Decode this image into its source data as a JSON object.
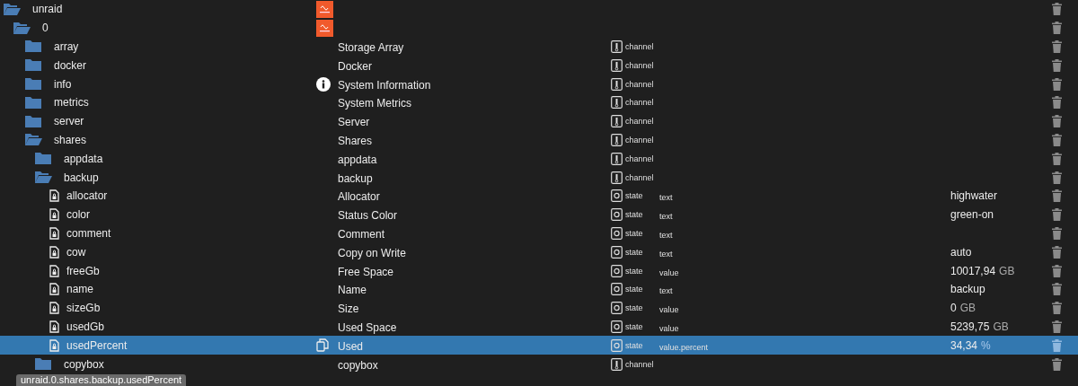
{
  "tree": [
    {
      "name": "unraid",
      "kind": "device",
      "expanded": true,
      "selected": false,
      "logo": true,
      "children": [
        {
          "name": "0",
          "kind": "device",
          "expanded": true,
          "selected": false,
          "logo": true,
          "children": [
            {
              "name": "array",
              "kind": "channel",
              "expanded": false,
              "selected": false,
              "title": "Storage Array",
              "role": "channel"
            },
            {
              "name": "docker",
              "kind": "channel",
              "expanded": false,
              "selected": false,
              "title": "Docker",
              "role": "channel"
            },
            {
              "name": "info",
              "kind": "channel",
              "expanded": false,
              "selected": false,
              "info_icon": true,
              "title": "System Information",
              "role": "channel"
            },
            {
              "name": "metrics",
              "kind": "channel",
              "expanded": false,
              "selected": false,
              "title": "System Metrics",
              "role": "channel"
            },
            {
              "name": "server",
              "kind": "channel",
              "expanded": false,
              "selected": false,
              "title": "Server",
              "role": "channel"
            },
            {
              "name": "shares",
              "kind": "channel",
              "expanded": true,
              "selected": false,
              "title": "Shares",
              "role": "channel",
              "children": [
                {
                  "name": "appdata",
                  "kind": "channel",
                  "expanded": false,
                  "selected": false,
                  "title": "appdata",
                  "role": "channel"
                },
                {
                  "name": "backup",
                  "kind": "channel",
                  "expanded": true,
                  "selected": false,
                  "title": "backup",
                  "role": "channel",
                  "children": [
                    {
                      "name": "allocator",
                      "kind": "state",
                      "selected": false,
                      "title": "Allocator",
                      "role": "state",
                      "type": "text",
                      "value": "highwater"
                    },
                    {
                      "name": "color",
                      "kind": "state",
                      "selected": false,
                      "title": "Status Color",
                      "role": "state",
                      "type": "text",
                      "value": "green-on"
                    },
                    {
                      "name": "comment",
                      "kind": "state",
                      "selected": false,
                      "title": "Comment",
                      "role": "state",
                      "type": "text"
                    },
                    {
                      "name": "cow",
                      "kind": "state",
                      "selected": false,
                      "title": "Copy on Write",
                      "role": "state",
                      "type": "text",
                      "value": "auto"
                    },
                    {
                      "name": "freeGb",
                      "kind": "state",
                      "selected": false,
                      "title": "Free Space",
                      "role": "state",
                      "type": "value",
                      "value": "10017,94",
                      "unit": "GB"
                    },
                    {
                      "name": "name",
                      "kind": "state",
                      "selected": false,
                      "title": "Name",
                      "role": "state",
                      "type": "text",
                      "value": "backup"
                    },
                    {
                      "name": "sizeGb",
                      "kind": "state",
                      "selected": false,
                      "title": "Size",
                      "role": "state",
                      "type": "value",
                      "value": "0",
                      "unit": "GB"
                    },
                    {
                      "name": "usedGb",
                      "kind": "state",
                      "selected": false,
                      "title": "Used Space",
                      "role": "state",
                      "type": "value",
                      "value": "5239,75",
                      "unit": "GB"
                    },
                    {
                      "name": "usedPercent",
                      "kind": "state",
                      "selected": true,
                      "copy_icon": true,
                      "title": "Used",
                      "role": "state",
                      "type": "value.percent",
                      "value": "34,34",
                      "unit": "%"
                    }
                  ]
                },
                {
                  "name": "copybox",
                  "kind": "channel",
                  "expanded": false,
                  "selected": false,
                  "title": "copybox",
                  "role": "channel"
                }
              ]
            }
          ]
        }
      ]
    }
  ],
  "tooltip": "unraid.0.shares.backup.usedPercent"
}
